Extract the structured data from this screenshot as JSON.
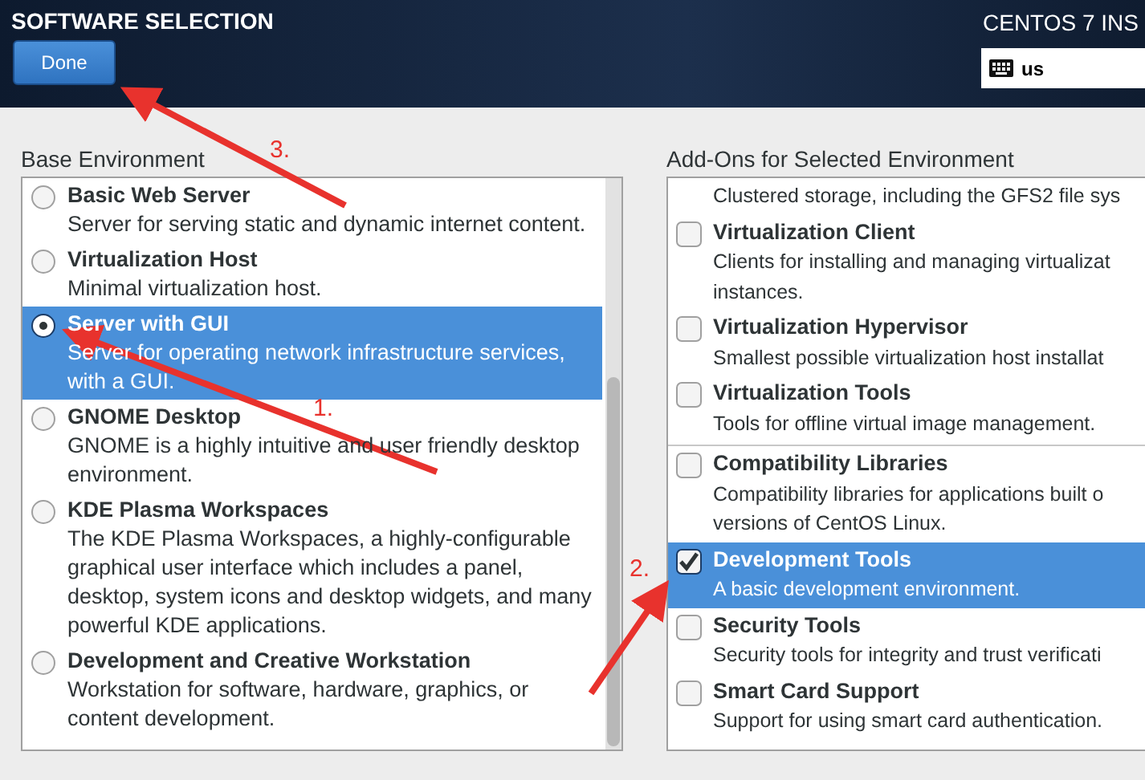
{
  "header": {
    "title": "SOFTWARE SELECTION",
    "done_button": "Done",
    "product": "CENTOS 7 INS",
    "keyboard_layout": "us"
  },
  "base_environment": {
    "heading": "Base Environment",
    "items": [
      {
        "name": "Basic Web Server",
        "description": "Server for serving static and dynamic internet content.",
        "selected": false
      },
      {
        "name": "Virtualization Host",
        "description": "Minimal virtualization host.",
        "selected": false
      },
      {
        "name": "Server with GUI",
        "description": "Server for operating network infrastructure services, with a GUI.",
        "selected": true
      },
      {
        "name": "GNOME Desktop",
        "description": "GNOME is a highly intuitive and user friendly desktop environment.",
        "selected": false
      },
      {
        "name": "KDE Plasma Workspaces",
        "description": "The KDE Plasma Workspaces, a highly-configurable graphical user interface which includes a panel, desktop, system icons and desktop widgets, and many powerful KDE applications.",
        "selected": false
      },
      {
        "name": "Development and Creative Workstation",
        "description": "Workstation for software, hardware, graphics, or content development.",
        "selected": false
      }
    ]
  },
  "addons": {
    "heading": "Add-Ons for Selected Environment",
    "groups": [
      [
        {
          "description": "Clustered storage, including the GFS2 file sys"
        },
        {
          "name": "Virtualization Client",
          "description": "Clients for installing and managing virtualizat",
          "description_2": "instances.",
          "checked": false,
          "selected": false
        },
        {
          "name": "Virtualization Hypervisor",
          "description": "Smallest possible virtualization host installat",
          "checked": false,
          "selected": false
        },
        {
          "name": "Virtualization Tools",
          "description": "Tools for offline virtual image management.",
          "checked": false,
          "selected": false
        }
      ],
      [
        {
          "name": "Compatibility Libraries",
          "description": "Compatibility libraries for applications built o",
          "description_2": "versions of CentOS Linux.",
          "checked": false,
          "selected": false
        },
        {
          "name": "Development Tools",
          "description": "A basic development environment.",
          "checked": true,
          "selected": true
        },
        {
          "name": "Security Tools",
          "description": "Security tools for integrity and trust verificati",
          "checked": false,
          "selected": false
        },
        {
          "name": "Smart Card Support",
          "description": "Support for using smart card authentication.",
          "checked": false,
          "selected": false
        }
      ]
    ]
  },
  "annotations": [
    {
      "label": "3."
    },
    {
      "label": "1."
    },
    {
      "label": "2."
    }
  ]
}
